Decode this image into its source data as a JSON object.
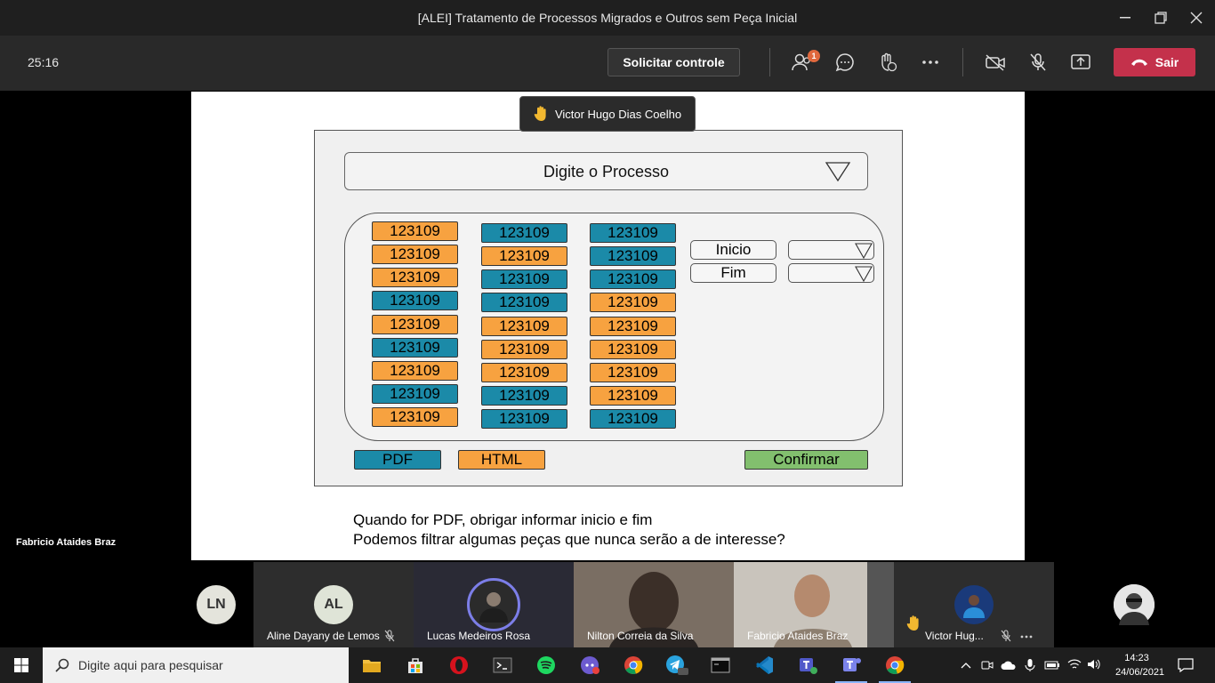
{
  "window": {
    "title": "[ALEI] Tratamento de Processos Migrados e Outros sem Peça Inicial"
  },
  "toolbar": {
    "timer": "25:16",
    "request_control": "Solicitar controle",
    "participants_badge": "1",
    "leave_label": "Sair",
    "accent_leave": "#c4314b"
  },
  "tooltip": {
    "raised_hand_name": "Victor Hugo Dias Coelho"
  },
  "mockup": {
    "process_select": "Digite o Processo",
    "columns": [
      [
        {
          "v": "123109",
          "c": "o"
        },
        {
          "v": "123109",
          "c": "o"
        },
        {
          "v": "123109",
          "c": "o"
        },
        {
          "v": "123109",
          "c": "b"
        },
        {
          "v": "123109",
          "c": "o"
        },
        {
          "v": "123109",
          "c": "b"
        },
        {
          "v": "123109",
          "c": "o"
        },
        {
          "v": "123109",
          "c": "b"
        },
        {
          "v": "123109",
          "c": "o"
        }
      ],
      [
        {
          "v": "123109",
          "c": "b"
        },
        {
          "v": "123109",
          "c": "o"
        },
        {
          "v": "123109",
          "c": "b"
        },
        {
          "v": "123109",
          "c": "b"
        },
        {
          "v": "123109",
          "c": "o"
        },
        {
          "v": "123109",
          "c": "o"
        },
        {
          "v": "123109",
          "c": "o"
        },
        {
          "v": "123109",
          "c": "b"
        },
        {
          "v": "123109",
          "c": "b"
        }
      ],
      [
        {
          "v": "123109",
          "c": "b"
        },
        {
          "v": "123109",
          "c": "b"
        },
        {
          "v": "123109",
          "c": "b"
        },
        {
          "v": "123109",
          "c": "o"
        },
        {
          "v": "123109",
          "c": "o"
        },
        {
          "v": "123109",
          "c": "o"
        },
        {
          "v": "123109",
          "c": "o"
        },
        {
          "v": "123109",
          "c": "o"
        },
        {
          "v": "123109",
          "c": "b"
        }
      ]
    ],
    "start_label": "Inicio",
    "end_label": "Fim",
    "pdf_button": "PDF",
    "html_button": "HTML",
    "confirm_button": "Confirmar",
    "colors": {
      "orange": "#f7a240",
      "blue": "#1b8aa8",
      "green": "#82bf6e"
    }
  },
  "notes": {
    "line1": "Quando for PDF, obrigar informar inicio e fim",
    "line2": "Podemos filtrar algumas peças que nunca serão a de interesse?"
  },
  "presenter": "Fabricio Ataides Braz",
  "participants": [
    {
      "initials": "LN",
      "name": ""
    },
    {
      "initials": "AL",
      "name": "Aline Dayany de Lemos"
    },
    {
      "initials": "",
      "name": "Lucas Medeiros Rosa"
    },
    {
      "initials": "",
      "name": "Nilton Correia da Silva"
    },
    {
      "initials": "",
      "name": "Fabricio Ataides Braz"
    },
    {
      "initials": "",
      "name": "Victor Hug..."
    }
  ],
  "taskbar": {
    "search_placeholder": "Digite aqui para pesquisar",
    "time": "14:23",
    "date": "24/06/2021"
  }
}
